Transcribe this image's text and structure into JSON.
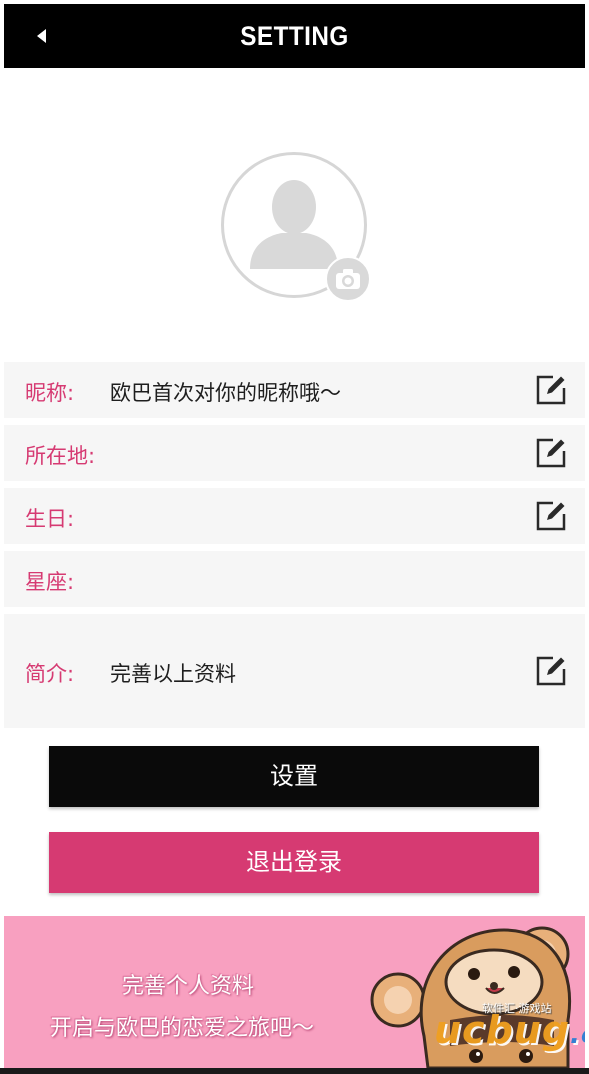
{
  "header": {
    "title": "SETTING",
    "back_icon": "back-arrow-icon"
  },
  "profile": {
    "avatar_icon": "avatar-placeholder-icon",
    "camera_icon": "camera-icon"
  },
  "form": {
    "nickname": {
      "label": "昵称:",
      "value": "欧巴首次对你的昵称哦～",
      "edit_icon": "edit-icon"
    },
    "location": {
      "label": "所在地:",
      "value": "",
      "edit_icon": "edit-icon"
    },
    "birthday": {
      "label": "生日:",
      "value": "",
      "edit_icon": "edit-icon"
    },
    "zodiac": {
      "label": "星座:",
      "value": ""
    },
    "bio": {
      "label": "简介:",
      "value": "完善以上资料",
      "edit_icon": "edit-icon"
    }
  },
  "actions": {
    "settings_label": "设置",
    "logout_label": "退出登录"
  },
  "banner": {
    "line1": "完善个人资料",
    "line2": "开启与欧巴的恋爱之旅吧～",
    "watermark_main": "ucbug",
    "watermark_suffix": ".cc",
    "watermark_small": "软件汇·游戏站"
  },
  "colors": {
    "accent": "#d63a72",
    "header_bg": "#000000",
    "row_bg": "#f6f6f6",
    "banner_bg": "#f8a0c0"
  }
}
